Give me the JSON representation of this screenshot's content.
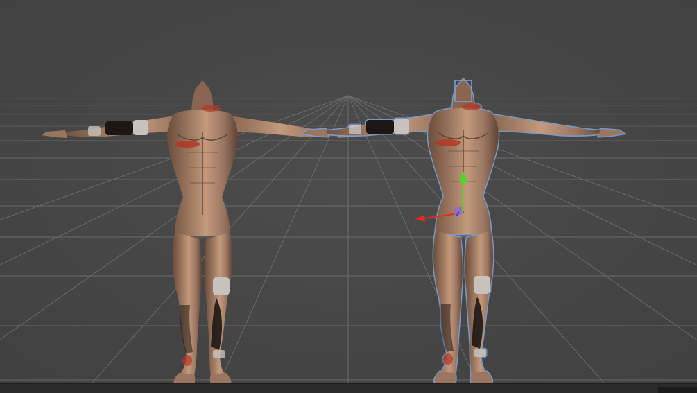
{
  "viewport": {
    "background_color": "#474747",
    "grid_line_color": "#8a8a8a",
    "horizon_color": "#4d4d4d"
  },
  "models": [
    {
      "id": "character-model-left",
      "selected": false
    },
    {
      "id": "character-model-right",
      "selected": true,
      "selection_outline_color": "#7fa3d6"
    }
  ],
  "gizmo": {
    "x_axis_color": "#e02a22",
    "y_axis_color": "#3fe21c",
    "z_axis_color": "#3a3ae0",
    "center_color": "#8c6fc4"
  },
  "skin": {
    "base_color": "#a07c63",
    "shadow_color": "#6b4d3c",
    "highlight_color": "#c49a7c",
    "wound_color": "#b33826",
    "bandage_color": "#c8c2bd",
    "tattoo_color": "#1c1614"
  }
}
